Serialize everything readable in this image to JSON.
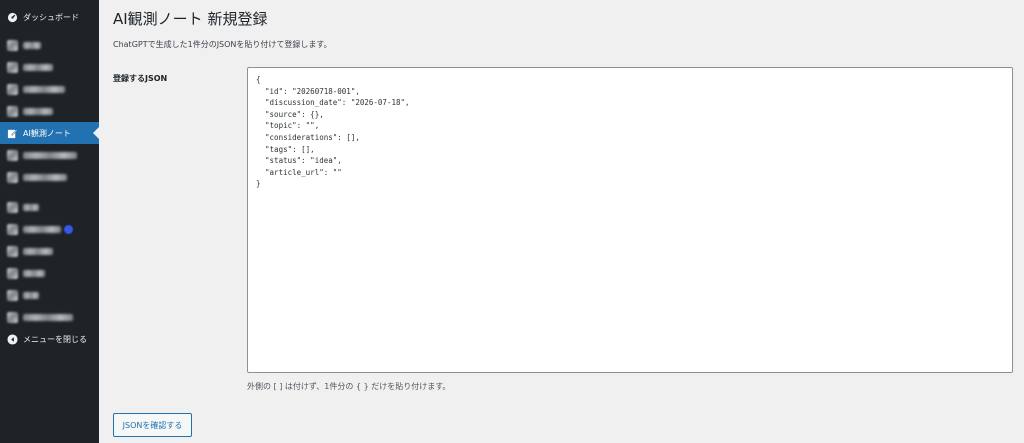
{
  "sidebar": {
    "dashboard": {
      "label": "ダッシュボード",
      "icon": "gauge-icon"
    },
    "active_item": {
      "label": "AI観測ノート",
      "icon": "edit-icon"
    },
    "collapse": {
      "label": "メニューを閉じる",
      "icon": "collapse-circle-icon"
    },
    "colors": {
      "background": "#1d2327",
      "active": "#2271b1",
      "badge": "#3858e9"
    }
  },
  "page": {
    "title": "AI観測ノート 新規登録",
    "description": "ChatGPTで生成した1件分のJSONを貼り付けて登録します。",
    "json_label": "登録するJSON",
    "json_value": "{\n  \"id\": \"20260718-001\",\n  \"discussion_date\": \"2026-07-18\",\n  \"source\": {},\n  \"topic\": \"\",\n  \"considerations\": [],\n  \"tags\": [],\n  \"status\": \"idea\",\n  \"article_url\": \"\"\n}",
    "hint": "外側の [ ] は付けず、1件分の { } だけを貼り付けます。",
    "confirm_button": "JSONを確認する"
  }
}
